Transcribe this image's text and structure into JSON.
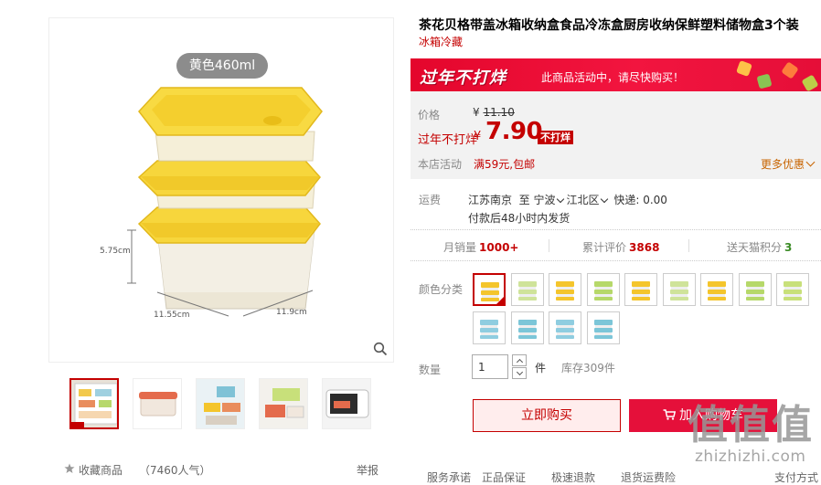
{
  "gallery": {
    "color_pill": "黄色460ml",
    "dimensions": {
      "height": "5.75cm",
      "width": "11.55cm",
      "depth": "11.9cm"
    },
    "thumbnails": [
      "thumb-1",
      "thumb-2",
      "thumb-3",
      "thumb-4",
      "thumb-5"
    ],
    "favorite_label": "收藏商品",
    "favorite_count": "（7460人气）",
    "report_label": "举报"
  },
  "product": {
    "title": "茶花贝格带盖冰箱收纳盒食品冷冻盒厨房收纳保鲜塑料储物盒3个装",
    "subtitle": "冰箱冷藏"
  },
  "promo": {
    "logo": "过年不打烊",
    "message": "此商品活动中，请尽快购买！"
  },
  "price": {
    "label": "价格",
    "yen": "¥",
    "original": "11.10",
    "promo_label": "过年不打烊",
    "promo_yen": "¥",
    "promo_value": "7.90",
    "badge": "不打烊",
    "shop_label": "本店活动",
    "shop_value": "满59元,包邮",
    "more_label": "更多优惠"
  },
  "shipping": {
    "label": "运费",
    "from": "江苏南京",
    "to_word": "至",
    "dest_city": "宁波",
    "dest_district": "江北区",
    "fee": "快递: 0.00",
    "dispatch": "付款后48小时内发货"
  },
  "stats": {
    "sales_label": "月销量",
    "sales_value": "1000+",
    "reviews_label": "累计评价",
    "reviews_value": "3868",
    "points_label": "送天猫积分",
    "points_value": "3"
  },
  "sku": {
    "color_label": "颜色分类",
    "swatch_colors": [
      "#f4c52c",
      "#cfe39a",
      "#f4c52c",
      "#b6d86a",
      "#f4c52c",
      "#cfe39a",
      "#f4c52c",
      "#b6d86a",
      "#c8e07a",
      "#8fcde0",
      "#7cc6d8",
      "#8fcde0",
      "#7cc6d8"
    ],
    "selected_index": 0
  },
  "quantity": {
    "label": "数量",
    "value": "1",
    "unit": "件",
    "stock": "库存309件"
  },
  "actions": {
    "buy_label": "立即购买",
    "cart_label": "加入购物车"
  },
  "service": {
    "label": "服务承诺",
    "items": [
      "正品保证",
      "极速退款",
      "退货运费险",
      "支付方式"
    ]
  },
  "watermark": {
    "logo_text": "值",
    "site": "zhizhizhi.com"
  }
}
